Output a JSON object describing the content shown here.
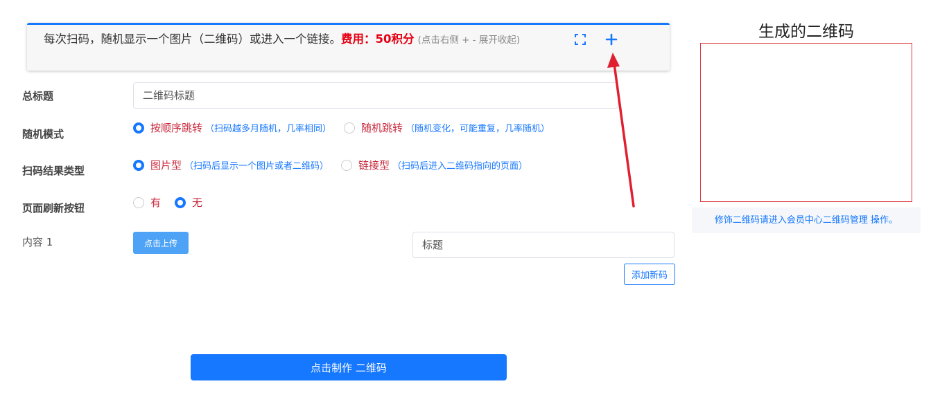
{
  "banner": {
    "main_text": "每次扫码，随机显示一个图片（二维码）或进入一个链接。",
    "fee_text": "费用：50积分",
    "hint_text": "(点击右侧 + - 展开收起)",
    "expand_icon": "fullscreen-icon",
    "plus_icon": "plus-icon",
    "accent_color": "#1677ff"
  },
  "form": {
    "title_label": "总标题",
    "title_placeholder": "二维码标题",
    "mode_label": "随机模式",
    "mode_options": [
      {
        "label": "按顺序跳转",
        "hint": "（扫码越多月随机，几率相同）",
        "checked": true
      },
      {
        "label": "随机跳转",
        "hint": "（随机变化，可能重复，几率随机）",
        "checked": false
      }
    ],
    "result_label": "扫码结果类型",
    "result_options": [
      {
        "label": "图片型",
        "hint": "（扫码后显示一个图片或者二维码）",
        "checked": true
      },
      {
        "label": "链接型",
        "hint": "（扫码后进入二维码指向的页面）",
        "checked": false
      }
    ],
    "refresh_label": "页面刷新按钮",
    "refresh_options": [
      {
        "label": "有",
        "checked": false
      },
      {
        "label": "无",
        "checked": true
      }
    ],
    "content_label": "内容 1",
    "upload_label": "点击上传",
    "content_title_placeholder": "标题",
    "add_label": "添加新码",
    "make_label": "点击制作 二维码"
  },
  "preview": {
    "title": "生成的二维码",
    "note": "修饰二维码请进入会员中心二维码管理 操作。",
    "border_color": "#d9363e"
  }
}
